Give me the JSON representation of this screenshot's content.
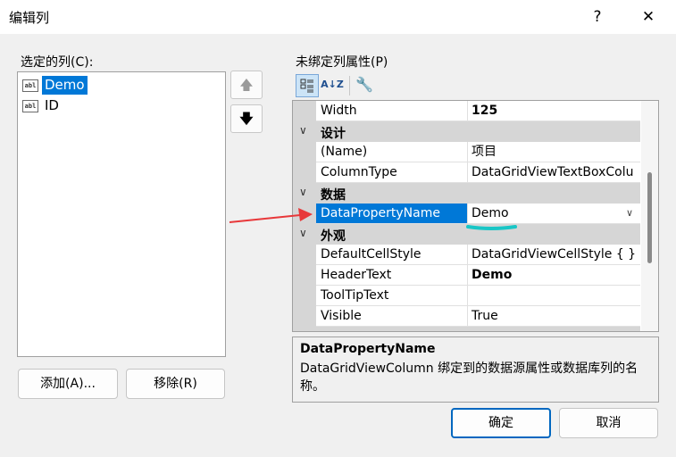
{
  "window": {
    "title": "编辑列",
    "help_label": "?",
    "close_label": "✕"
  },
  "left": {
    "selected_columns_label": "选定的列(C):",
    "columns": [
      {
        "name": "Demo",
        "icon": "abl-textbox-icon",
        "selected": true
      },
      {
        "name": "ID",
        "icon": "abl-textbox-icon",
        "selected": false
      }
    ],
    "move_up_glyph": "🡅",
    "move_down_glyph": "🡇",
    "add_label": "添加(A)...",
    "remove_label": "移除(R)"
  },
  "right": {
    "unbound_props_label": "未绑定列属性(P)",
    "toolbar": {
      "categorized_icon": "categorized-icon",
      "alphabetical_icon": "sort-az-icon",
      "alphabetical_glyph": "A↓Z",
      "property_pages_icon": "wrench-icon",
      "property_pages_glyph": "🔧"
    },
    "grid": {
      "rows": [
        {
          "type": "prop",
          "name": "Width",
          "value": "125",
          "bold": true
        },
        {
          "type": "category",
          "name": "设计"
        },
        {
          "type": "prop",
          "name": "(Name)",
          "value": "项目",
          "bold": false
        },
        {
          "type": "prop",
          "name": "ColumnType",
          "value": "DataGridViewTextBoxColu",
          "bold": false
        },
        {
          "type": "category",
          "name": "数据"
        },
        {
          "type": "prop",
          "name": "DataPropertyName",
          "value": "Demo",
          "bold": false,
          "selected": true
        },
        {
          "type": "category",
          "name": "外观"
        },
        {
          "type": "prop",
          "name": "DefaultCellStyle",
          "value": "DataGridViewCellStyle { }",
          "bold": false
        },
        {
          "type": "prop",
          "name": "HeaderText",
          "value": "Demo",
          "bold": true
        },
        {
          "type": "prop",
          "name": "ToolTipText",
          "value": "",
          "bold": false
        },
        {
          "type": "prop",
          "name": "Visible",
          "value": "True",
          "bold": false
        }
      ],
      "chevron_glyph": "∨",
      "dropdown_glyph": "∨"
    },
    "description": {
      "title": "DataPropertyName",
      "text": "DataGridViewColumn 绑定到的数据源属性或数据库列的名称。"
    }
  },
  "footer": {
    "ok_label": "确定",
    "cancel_label": "取消"
  },
  "colors": {
    "selection": "#0078d7",
    "category_bg": "#d6d6d6",
    "annotation_arrow": "#e8383a",
    "annotation_underline": "#19c6c6"
  }
}
